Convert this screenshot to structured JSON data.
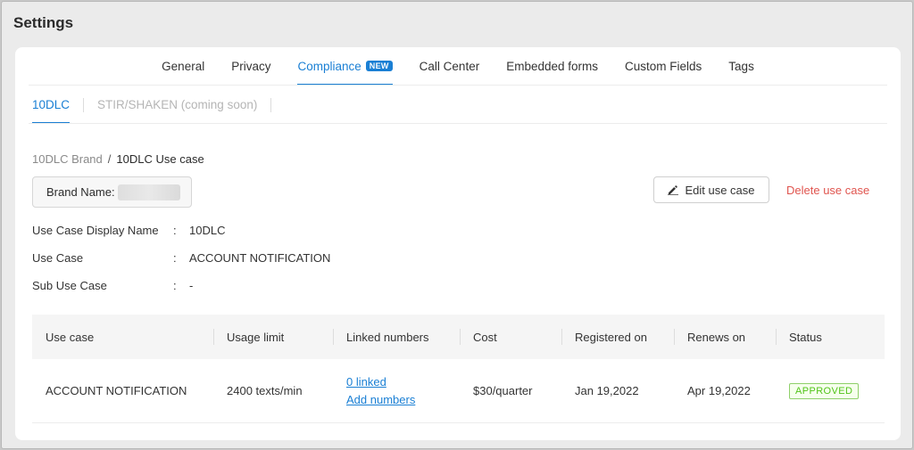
{
  "page": {
    "title": "Settings"
  },
  "tabs": [
    {
      "label": "General"
    },
    {
      "label": "Privacy"
    },
    {
      "label": "Compliance",
      "badge": "NEW",
      "active": true
    },
    {
      "label": "Call Center"
    },
    {
      "label": "Embedded forms"
    },
    {
      "label": "Custom Fields"
    },
    {
      "label": "Tags"
    }
  ],
  "subtabs": [
    {
      "label": "10DLC",
      "active": true
    },
    {
      "label": "STIR/SHAKEN (coming soon)",
      "disabled": true
    }
  ],
  "breadcrumb": {
    "parent": "10DLC Brand",
    "separator": "/",
    "current": "10DLC Use case"
  },
  "brand": {
    "label": "Brand Name:"
  },
  "actions": {
    "edit_label": "Edit use case",
    "delete_label": "Delete use case"
  },
  "details": [
    {
      "label": "Use Case Display Name",
      "colon": ":",
      "value": "10DLC"
    },
    {
      "label": "Use Case",
      "colon": ":",
      "value": "ACCOUNT NOTIFICATION"
    },
    {
      "label": "Sub Use Case",
      "colon": ":",
      "value": "-"
    }
  ],
  "table": {
    "columns": [
      "Use case",
      "Usage limit",
      "Linked numbers",
      "Cost",
      "Registered on",
      "Renews on",
      "Status"
    ],
    "rows": [
      {
        "use_case": "ACCOUNT NOTIFICATION",
        "usage_limit": "2400 texts/min",
        "linked_count": "0 linked",
        "add_numbers": "Add numbers",
        "cost": "$30/quarter",
        "registered_on": "Jan 19,2022",
        "renews_on": "Apr 19,2022",
        "status": "APPROVED"
      }
    ]
  },
  "colors": {
    "accent": "#1a7fd4",
    "danger": "#e0554f",
    "approved": "#52c41a"
  }
}
